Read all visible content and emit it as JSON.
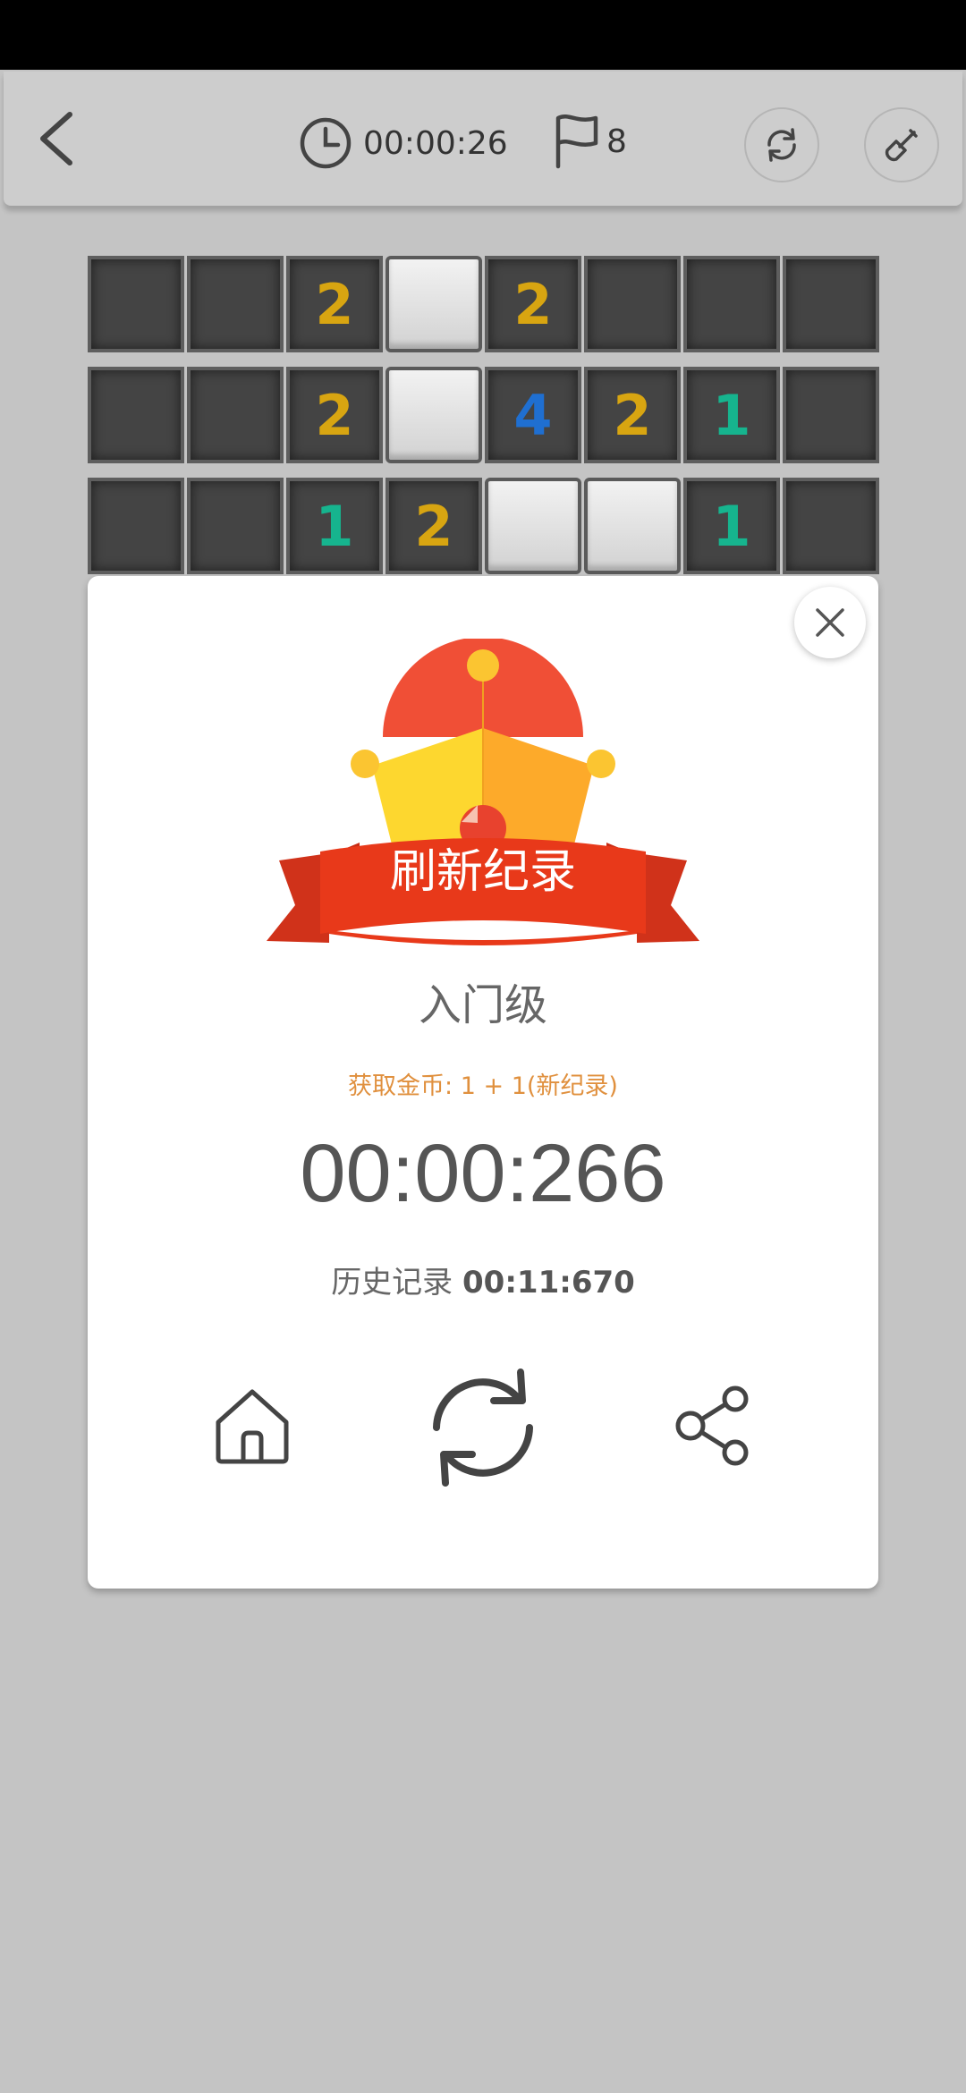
{
  "topbar": {
    "timer": "00:00:26",
    "flags": "8"
  },
  "board": {
    "rows": [
      [
        {
          "s": "hidden",
          "v": ""
        },
        {
          "s": "hidden",
          "v": ""
        },
        {
          "s": "hidden",
          "v": "2"
        },
        {
          "s": "open",
          "v": ""
        },
        {
          "s": "hidden",
          "v": "2"
        },
        {
          "s": "hidden",
          "v": ""
        },
        {
          "s": "hidden",
          "v": ""
        },
        {
          "s": "hidden",
          "v": ""
        }
      ],
      [
        {
          "s": "hidden",
          "v": ""
        },
        {
          "s": "hidden",
          "v": ""
        },
        {
          "s": "hidden",
          "v": "2"
        },
        {
          "s": "open",
          "v": ""
        },
        {
          "s": "hidden",
          "v": "4"
        },
        {
          "s": "hidden",
          "v": "2"
        },
        {
          "s": "hidden",
          "v": "1"
        },
        {
          "s": "hidden",
          "v": ""
        }
      ],
      [
        {
          "s": "hidden",
          "v": ""
        },
        {
          "s": "hidden",
          "v": ""
        },
        {
          "s": "hidden",
          "v": "1"
        },
        {
          "s": "hidden",
          "v": "2"
        },
        {
          "s": "open",
          "v": ""
        },
        {
          "s": "open",
          "v": ""
        },
        {
          "s": "hidden",
          "v": "1"
        },
        {
          "s": "hidden",
          "v": ""
        }
      ]
    ],
    "number_colors": {
      "1": "#16b48e",
      "2": "#d8a511",
      "4": "#1f6fd1"
    }
  },
  "dialog": {
    "banner": "刷新纪录",
    "level": "入门级",
    "coins": "获取金币: 1 + 1(新纪录)",
    "time": "00:00:266",
    "history_label": "历史记录",
    "history_value": "00:11:670"
  },
  "colors": {
    "background": "#c4c4c4",
    "crown_red": "#f04f36",
    "crown_yellow": "#fbd22b",
    "banner_red": "#e8391a"
  }
}
